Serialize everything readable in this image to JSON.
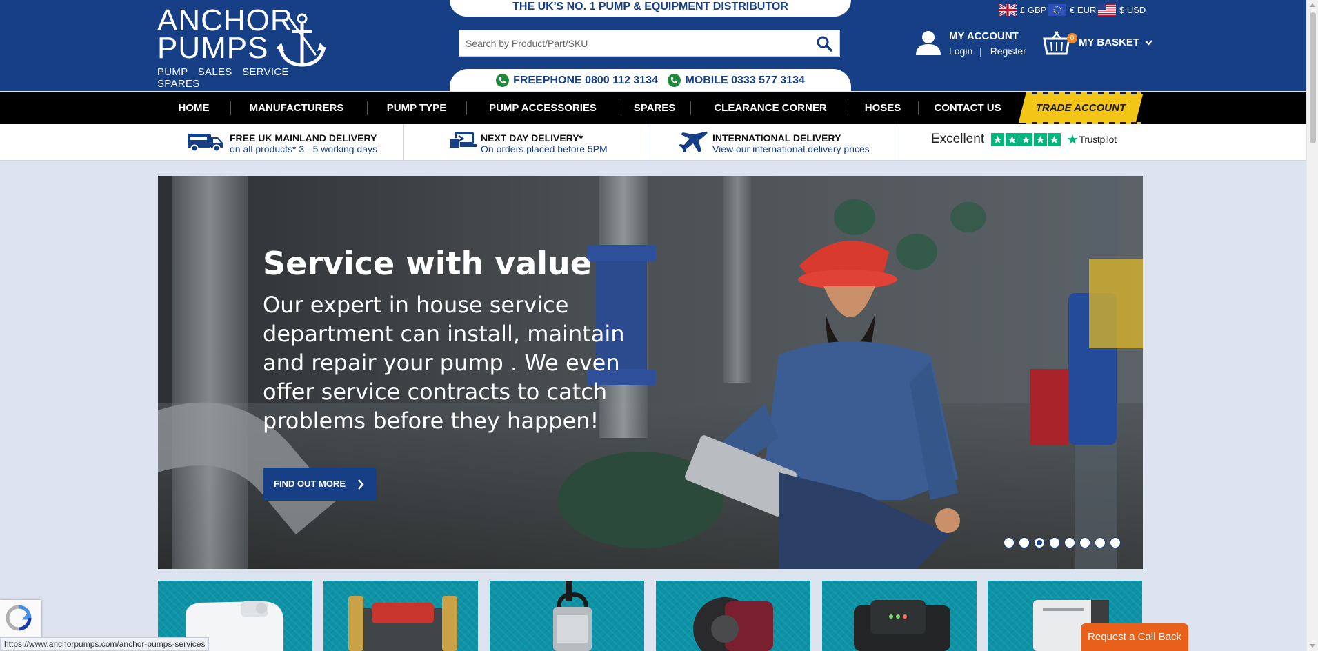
{
  "header": {
    "logo": {
      "line1": "ANCHOR",
      "line2": "PUMPS",
      "tagline": "PUMP SALES SERVICE SPARES"
    },
    "banner_top": "THE UK'S NO. 1 PUMP & EQUIPMENT DISTRIBUTOR",
    "search": {
      "placeholder": "Search by Product/Part/SKU",
      "value": ""
    },
    "phones": {
      "freephone": "FREEPHONE 0800 112 3134",
      "mobile": "MOBILE 0333 577 3134"
    },
    "currencies": [
      {
        "label": "£ GBP",
        "flag": "uk-flag-icon"
      },
      {
        "label": "€ EUR",
        "flag": "eu-flag-icon"
      },
      {
        "label": "$ USD",
        "flag": "us-flag-icon"
      }
    ],
    "account": {
      "title": "MY ACCOUNT",
      "login": "Login",
      "separator": "|",
      "register": "Register"
    },
    "basket": {
      "label": "MY BASKET",
      "count": "0"
    }
  },
  "nav": {
    "items": [
      "HOME",
      "MANUFACTURERS",
      "PUMP TYPE",
      "PUMP ACCESSORIES",
      "SPARES",
      "CLEARANCE CORNER",
      "HOSES",
      "CONTACT US"
    ],
    "trade": "TRADE ACCOUNT"
  },
  "delivery": [
    {
      "title": "FREE UK MAINLAND DELIVERY",
      "subtitle": "on all products* 3 - 5 working days",
      "icon": "van-icon"
    },
    {
      "title": "NEXT DAY DELIVERY*",
      "subtitle": "On orders placed before 5PM",
      "icon": "laptop-box-icon"
    },
    {
      "title": "INTERNATIONAL DELIVERY",
      "subtitle": "View our international delivery prices",
      "icon": "airplane-icon"
    }
  ],
  "trustpilot": {
    "rating_label": "Excellent",
    "stars": 5,
    "brand": "Trustpilot"
  },
  "hero": {
    "headline": "Service with value",
    "body": "Our expert in house service department can install, maintain and repair your pump .  We even offer service contracts to catch problems before they happen!",
    "cta": "FIND OUT MORE",
    "slide_count": 8,
    "active_slide": 3
  },
  "tiles": [
    "macerator-product",
    "booster-pump-product",
    "submersible-pump-product",
    "circulator-pump-product",
    "grundfos-circulator-product",
    "boiler-controller-product"
  ],
  "statusbar": "https://www.anchorpumps.com/anchor-pumps-services",
  "callback": "Request a Call Back",
  "colors": {
    "brand_blue": "#163f86",
    "trade_yellow": "#f3c516",
    "tile_teal": "#0d93a6",
    "callback_orange": "#e8601a",
    "trustpilot_green": "#00b67a"
  }
}
